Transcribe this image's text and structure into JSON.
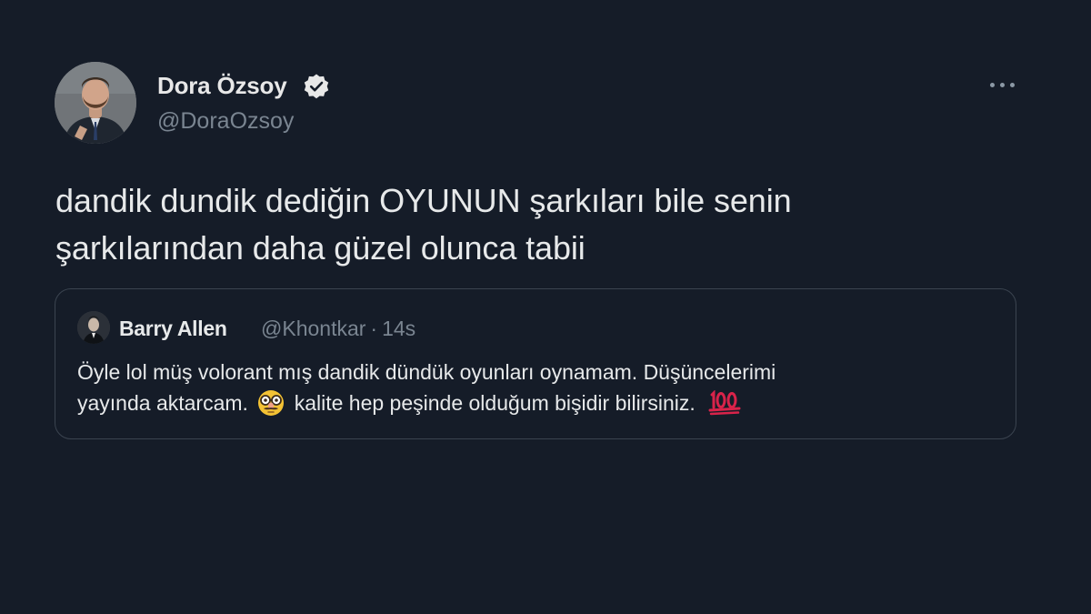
{
  "tweet": {
    "author_name": "Dora Özsoy",
    "handle": "@DoraOzsoy",
    "text_line1": "dandik dundik dediğin OYUNUN şarkıları bile senin",
    "text_line2": "şarkılarından daha güzel olunca tabii"
  },
  "quote": {
    "author_name": "Barry Allen",
    "handle": "@Khontkar",
    "separator": "·",
    "time": "14s",
    "line1": "Öyle lol müş volorant mış dandik dündük oyunları oynamam. Düşüncelerimi",
    "line2_before_emoji": "yayında aktarcam.",
    "line2_after_emoji": "kalite hep peşinde olduğum bişidir bilirsiniz.",
    "emoji_1": "disguised-face-emoji",
    "emoji_2": "hundred-points-emoji"
  },
  "colors": {
    "background": "#151c28",
    "text_primary": "#e7e9ea",
    "text_secondary": "#7a8591",
    "border": "#3b4450",
    "verified_badge": "#e8e8e8"
  }
}
